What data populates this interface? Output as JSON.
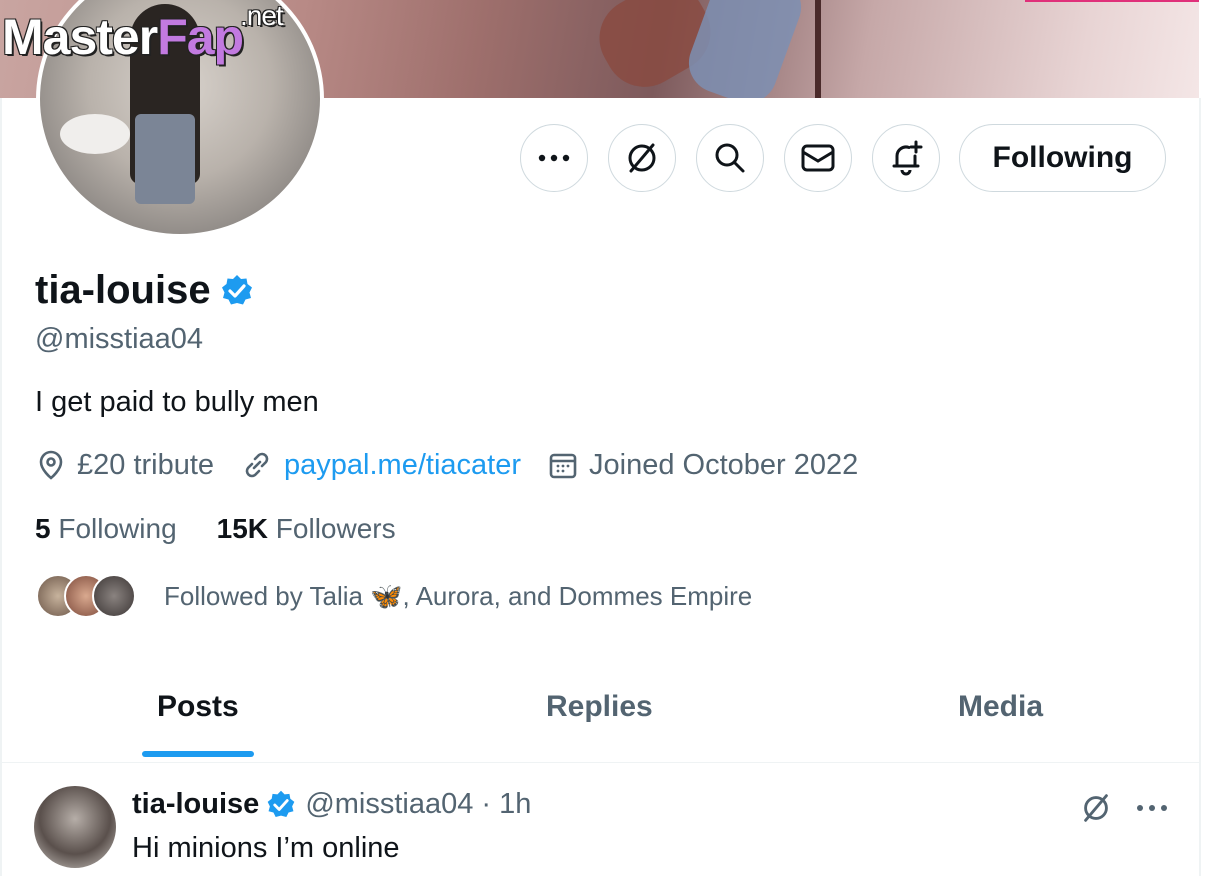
{
  "watermark": {
    "brand_a": "Master",
    "brand_b": "Fap",
    "brand_c": ".net"
  },
  "actions": {
    "more_icon": "more-horizontal-icon",
    "grok_icon": "slashed-circle-icon",
    "search_icon": "search-icon",
    "message_icon": "envelope-icon",
    "notify_icon": "bell-plus-icon",
    "follow_label": "Following"
  },
  "profile": {
    "display_name": "tia-louise",
    "handle": "@misstiaa04",
    "bio": "I get paid to bully men",
    "location": "£20 tribute",
    "website": "paypal.me/tiacater",
    "joined": "Joined October 2022",
    "following_count": "5",
    "following_label": "Following",
    "followers_count": "15K",
    "followers_label": "Followers",
    "followed_by": "Followed by Talia 🦋, Aurora, and Dommes Empire"
  },
  "tabs": [
    {
      "label": "Posts",
      "active": true
    },
    {
      "label": "Replies",
      "active": false
    },
    {
      "label": "Media",
      "active": false
    }
  ],
  "post": {
    "name": "tia-louise",
    "meta": "@misstiaa04 · 1h",
    "text": "Hi minions I’m online"
  },
  "colors": {
    "accent": "#1d9bf0",
    "secondary_text": "#536471",
    "primary_text": "#0f1419"
  }
}
